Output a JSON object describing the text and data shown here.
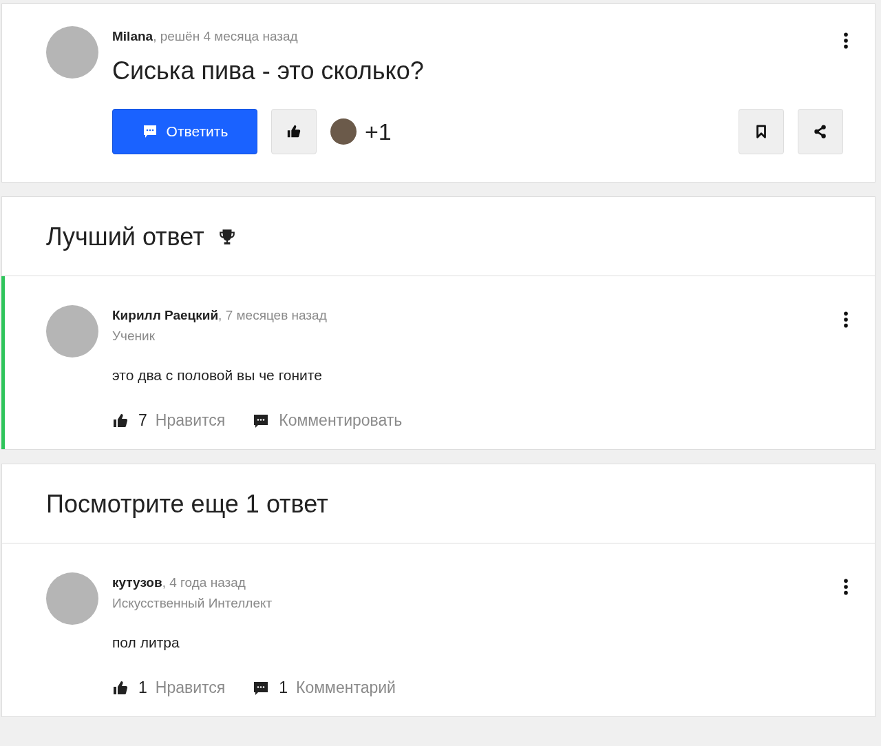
{
  "question": {
    "author": "Milana",
    "meta": ", решён 4 месяца назад",
    "title": "Сиська пива - это сколько?",
    "reply_button": "Ответить",
    "likers_more": "+1"
  },
  "best_answer": {
    "heading": "Лучший ответ",
    "answer": {
      "author": "Кирилл Раецкий",
      "meta": ", 7 месяцев назад",
      "rank": "Ученик",
      "text": "это два с половой вы че гоните",
      "best": true,
      "likes_count": "7",
      "likes_label": "Нравится",
      "comments_label": "Комментировать"
    }
  },
  "more_answers": {
    "heading": "Посмотрите еще 1 ответ",
    "answers": [
      {
        "author": "кутузов",
        "meta": ", 4 года назад",
        "rank": "Искусственный Интеллект",
        "text": "пол литра",
        "best": false,
        "likes_count": "1",
        "likes_label": "Нравится",
        "comments_count": "1",
        "comments_label": "Комментарий"
      }
    ]
  }
}
